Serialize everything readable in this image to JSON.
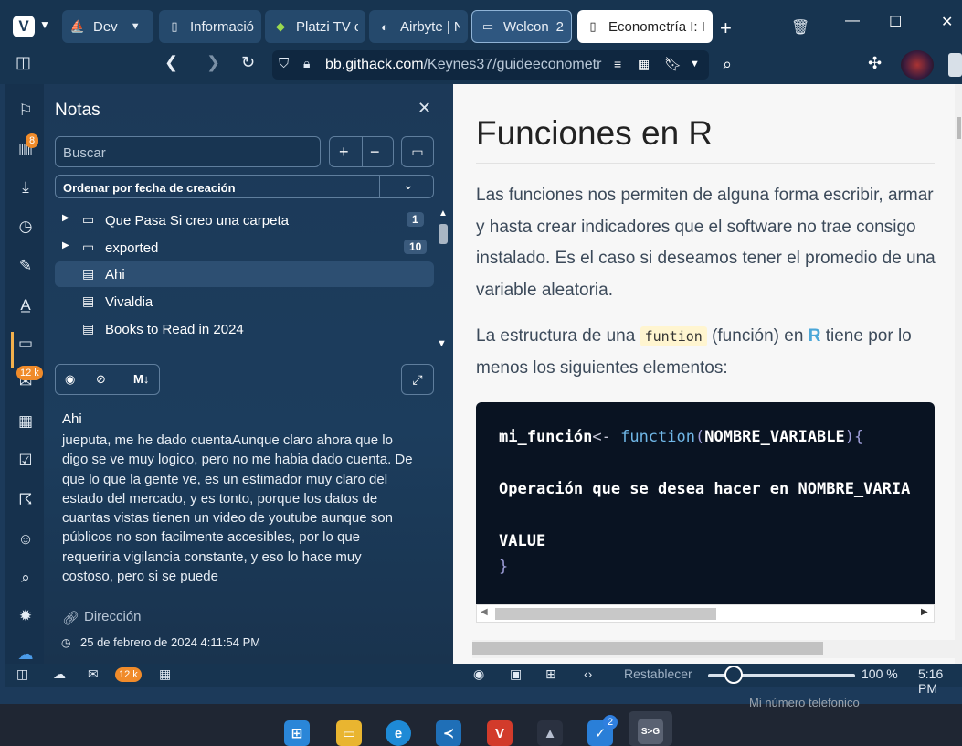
{
  "tabs": [
    {
      "label": "Dev",
      "icon": "sailboat-icon"
    },
    {
      "label": "Informació",
      "icon": "page-icon"
    },
    {
      "label": "Platzi TV es",
      "icon": "platzi-icon"
    },
    {
      "label": "Airbyte | N",
      "icon": "airbyte-icon"
    },
    {
      "label": "Welcon",
      "count": "2",
      "icon": "stack-icon"
    },
    {
      "label": "Econometría I: Ir",
      "icon": "page-icon"
    }
  ],
  "address": {
    "domain": "bb.githack.com",
    "path": "/Keynes37/guideeconometr"
  },
  "sidebar": {
    "badges": {
      "books": "8",
      "mail": "12 k"
    }
  },
  "notes": {
    "title": "Notas",
    "search_placeholder": "Buscar",
    "sort_label": "Ordenar por fecha de creación",
    "tree": [
      {
        "label": "Que Pasa Si creo una carpeta",
        "count": "1",
        "type": "folder"
      },
      {
        "label": "exported",
        "count": "10",
        "type": "folder"
      },
      {
        "label": "Ahi",
        "type": "note",
        "selected": true
      },
      {
        "label": "Vivaldia",
        "type": "note"
      },
      {
        "label": "Books to Read in 2024",
        "type": "note"
      }
    ],
    "note_title": "Ahi",
    "note_body": "jueputa, me he dado cuentaAunque claro ahora que lo digo se ve muy logico, pero no me habia dado cuenta. De que lo que la gente ve, es un estimador muy claro del estado del mercado, y es tonto, porque los datos de cuantas vistas tienen un video de youtube aunque son públicos no son facilmente accesibles, por lo que requeriria vigilancia constante, y eso lo hace muy costoso, pero si se puede",
    "address_label": "Dirección",
    "date": "25 de febrero de 2024 4:11:54 PM"
  },
  "content": {
    "heading": "Funciones en R",
    "para1": "Las funciones nos permiten de alguna forma escribir, armar y hasta crear indicadores que el software no trae consigo instalado. Es el caso si deseamos tener el promedio de una variable aleatoria.",
    "para2_before": "La estructura de una",
    "para2_code": "funtion",
    "para2_mid": "(función) en",
    "para2_r": "R",
    "para2_after": "tiene por lo menos los siguientes elementos:",
    "code": {
      "line1_name": "mi_función",
      "line1_op": "<-",
      "line1_fn": "function",
      "line1_paren_open": "(",
      "line1_arg": "NOMBRE_VARIABLE",
      "line1_paren_close": "){",
      "line2": "Operación que se desea hacer en NOMBRE_VARIA",
      "line3": "VALUE",
      "line4": "}"
    }
  },
  "statusbar": {
    "mail_badge": "12 k",
    "reset_label": "Restablecer",
    "zoom": "100 %",
    "time": "5:16 PM"
  },
  "taskbar": {
    "peek_text": "Mi número telefonico",
    "check_badge": "2"
  },
  "colors": {
    "accent": "#173450",
    "badge": "#f08b2a"
  }
}
